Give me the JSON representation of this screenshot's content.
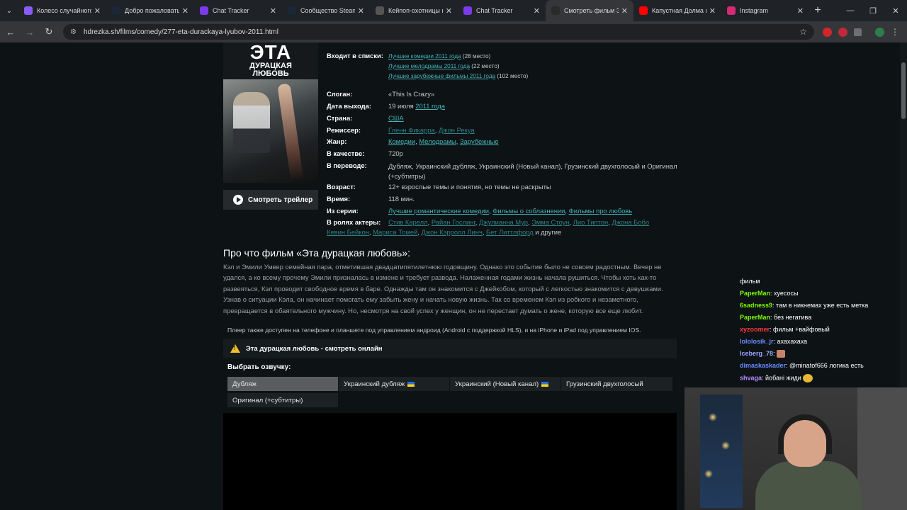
{
  "browser": {
    "tabs": [
      {
        "title": "Колесо случайного ...",
        "icon": "wheel-icon",
        "color": "#8a5cf6"
      },
      {
        "title": "Добро пожаловать ...",
        "icon": "steam-icon",
        "color": "#1b2838"
      },
      {
        "title": "Chat Tracker",
        "icon": "chat-tracker-icon",
        "color": "#7c3aed"
      },
      {
        "title": "Сообщество Steam ...",
        "icon": "steam-icon",
        "color": "#1b2838"
      },
      {
        "title": "Кейпоп-охотницы н...",
        "icon": "wikipedia-icon",
        "color": "#555555"
      },
      {
        "title": "Chat Tracker",
        "icon": "chat-tracker-icon",
        "color": "#7c3aed"
      },
      {
        "title": "Смотреть фильм Эт...",
        "icon": "hd-icon",
        "color": "#2a2a2a",
        "active": true
      },
      {
        "title": "Капустная Долма и ...",
        "icon": "youtube-icon",
        "color": "#ff0000"
      },
      {
        "title": "Instagram",
        "icon": "instagram-icon",
        "color": "#d62976"
      }
    ],
    "url": "hdrezka.sh/films/comedy/277-eta-durackaya-lyubov-2011.html"
  },
  "poster": {
    "title_big": "ЭТА",
    "title_small1": "ДУРАЦКАЯ",
    "title_small2": "ЛЮБОВЬ"
  },
  "trailer_label": "Смотреть трейлер",
  "info": {
    "lists_label": "Входит в списки:",
    "lists": [
      {
        "link": "Лучшие комедии 2011 года",
        "place": "(28 место)"
      },
      {
        "link": "Лучшие мелодрамы 2011 года",
        "place": "(22 место)"
      },
      {
        "link": "Лучшие зарубежные фильмы 2011 года",
        "place": "(102 место)"
      }
    ],
    "slogan_label": "Слоган:",
    "slogan": "«This Is Crazy»",
    "date_label": "Дата выхода:",
    "date_day": "19 июля",
    "date_year": "2011 года",
    "country_label": "Страна:",
    "country": "США",
    "director_label": "Режиссер:",
    "director1": "Гленн Фикарра",
    "director2": "Джон Рекуа",
    "genre_label": "Жанр:",
    "genre1": "Комедии",
    "genre2": "Мелодрамы",
    "genre3": "Зарубежные",
    "quality_label": "В качестве:",
    "quality": "720p",
    "translation_label": "В переводе:",
    "translation_line1": "Дубляж, Украинский дубляж, Украинский (Новый канал), Грузинский двухголосый и Оригинал",
    "translation_line2": "(+субтитры)",
    "age_label": "Возраст:",
    "age_value": "12+",
    "age_note": "взрослые темы и понятия, но темы не раскрыты",
    "time_label": "Время:",
    "time": "118 мин.",
    "series_label": "Из серии:",
    "series": [
      "Лучшие романтические комедии",
      "Фильмы о соблазнении",
      "Фильмы про любовь"
    ],
    "cast_label": "В ролях актеры:",
    "cast_line1": [
      "Стив Карелл",
      "Райан Гослинг",
      "Джулианна Мур",
      "Эмма Стоун",
      "Лио Типтон",
      "Джона Бобо"
    ],
    "cast_line2": [
      "Кевин Бейкон",
      "Мариса Томей",
      "Джон Кэрролл Линч",
      "Бет Литтлфорд"
    ],
    "cast_more": "и другие"
  },
  "about_title": "Про что фильм «Эта дурацкая любовь»:",
  "description": "Кэл и Эмили Умвер семейная пара, отметившая двадцатипятилетнюю годовщину. Однако это событие было не совсем радостным. Вечер не удался, а ко всему прочему Эмили призналась в измене и требует развода. Налаженная годами жизнь начала рушиться. Чтобы хоть как-то развеяться, Кэл проводит свободное время в баре. Однажды там он знакомится с Джейкобом, который с легкостью знакомится с девушками. Узнав о ситуации Кэла, он начинает помогать ему забыть жену и начать новую жизнь. Так со временем Кэл из робкого и незаметного, превращается в обаятельного мужчину. Но, несмотря на свой успех у женщин, он не перестает думать о жене, которую все еще любит.",
  "player_note": "Плеер также доступен на телефоне и планшете под управлением андроид (Android с поддержкой HLS), и на iPhone и iPad под управлением IOS.",
  "player_title": "Эта дурацкая любовь - смотреть онлайн",
  "choose_voice": "Выбрать озвучку:",
  "voices": [
    {
      "label": "Дубляж",
      "selected": true,
      "flag": false
    },
    {
      "label": "Украинский дубляж",
      "selected": false,
      "flag": true
    },
    {
      "label": "Украинский (Новый канал)",
      "selected": false,
      "flag": true
    },
    {
      "label": "Грузинский двухголосый",
      "selected": false,
      "flag": false
    },
    {
      "label": "Оригинал (+субтитры)",
      "selected": false,
      "flag": false
    }
  ],
  "chat": [
    {
      "user": "",
      "text": "фильм",
      "color": "#ffffff"
    },
    {
      "user": "PaperMan",
      "text": ": хуесосы",
      "color": "#7cfc00"
    },
    {
      "user": "6sadness9",
      "text": ": там в никнемах уже есть метка",
      "color": "#7cfc00"
    },
    {
      "user": "PaperMan",
      "text": ": без негатива",
      "color": "#7cfc00"
    },
    {
      "user": "xyzoomer",
      "text": ": фильм +вайфовый",
      "color": "#ff3b3b"
    },
    {
      "user": "lololosik_jr",
      "text": ": ахахахаха",
      "color": "#6a8cff"
    },
    {
      "user": "Iceberg_78",
      "text": ":",
      "color": "#9aa6ff",
      "emote": true
    },
    {
      "user": "dimaskaskader",
      "text": ": @minatof666 логика есть",
      "color": "#6a8cff"
    },
    {
      "user": "shvaga",
      "text": ": йобані жиди",
      "color": "#b58cff",
      "emote2": true
    }
  ]
}
